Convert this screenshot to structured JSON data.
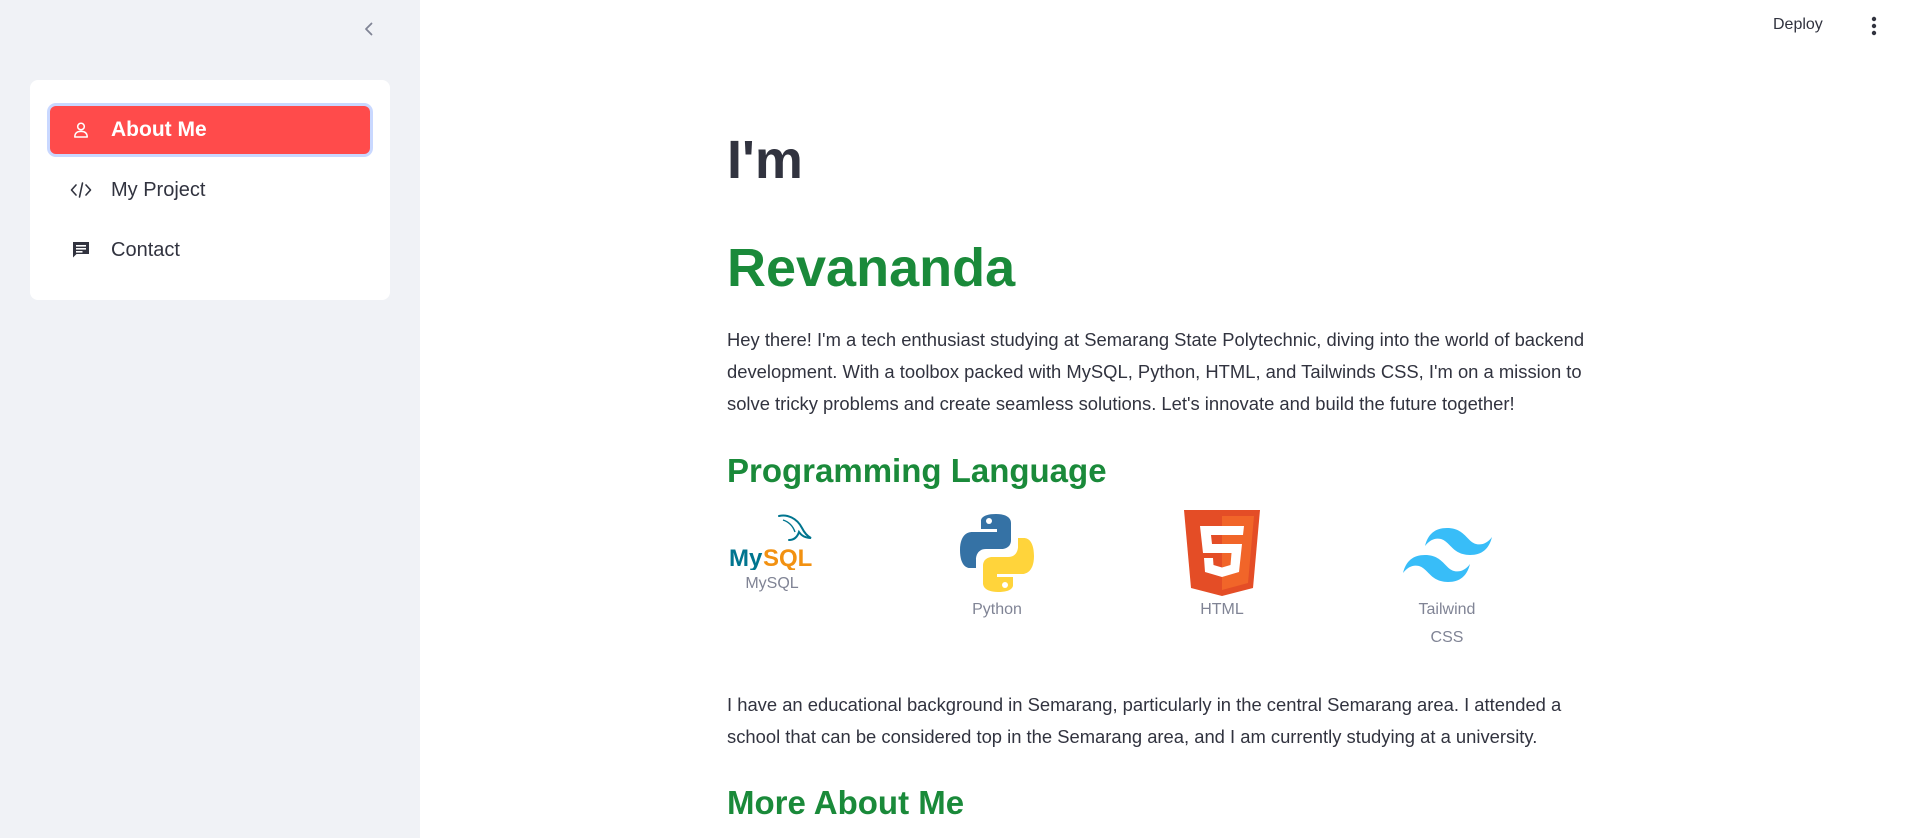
{
  "sidebar": {
    "collapse_icon": "chevron-left-icon",
    "items": [
      {
        "label": "About Me",
        "icon": "person-icon",
        "active": true
      },
      {
        "label": "My Project",
        "icon": "code-icon",
        "active": false
      },
      {
        "label": "Contact",
        "icon": "chat-icon",
        "active": false
      }
    ]
  },
  "toolbar": {
    "deploy_label": "Deploy",
    "menu_icon": "kebab-menu-icon"
  },
  "main": {
    "title_line1": "I'm",
    "title_line2": "Revananda",
    "intro": "Hey there! I'm a tech enthusiast studying at Semarang State Polytechnic, diving into the world of backend development. With a toolbox packed with MySQL, Python, HTML, and Tailwinds CSS, I'm on a mission to solve tricky problems and create seamless solutions. Let's innovate and build the future together!",
    "languages_heading": "Programming Language",
    "languages": [
      {
        "caption": "MySQL",
        "icon": "mysql-logo"
      },
      {
        "caption": "Python",
        "icon": "python-logo"
      },
      {
        "caption": "HTML",
        "icon": "html5-logo"
      },
      {
        "caption": "Tailwind CSS",
        "icon": "tailwind-logo"
      }
    ],
    "education": "I have an educational background in Semarang, particularly in the central Semarang area. I attended a school that can be considered top in the Semarang area, and I am currently studying at a university.",
    "more_heading": "More About Me"
  },
  "colors": {
    "accent": "#ff4b4b",
    "heading_green": "#1a8a3a",
    "sidebar_bg": "#f0f2f6",
    "text": "#31333f"
  }
}
